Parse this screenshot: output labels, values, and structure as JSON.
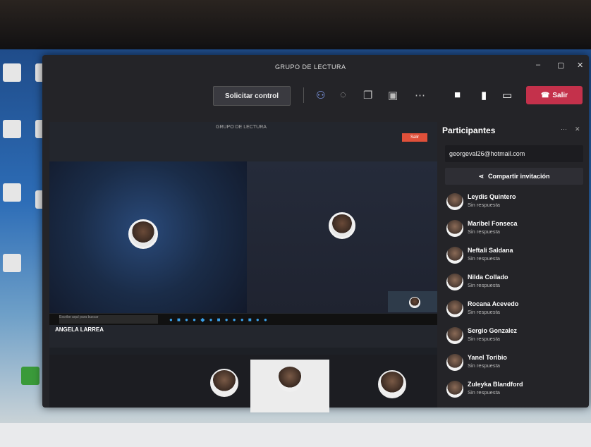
{
  "window": {
    "title": "GRUPO DE LECTURA",
    "minimize": "–",
    "maximize": "▢",
    "close": "✕"
  },
  "toolbar": {
    "control_button": "Solicitar control",
    "leave_button": "Salir",
    "icons": [
      "participants-icon",
      "reactions-icon",
      "chat-icon",
      "share-icon",
      "more-icon",
      "camera-icon",
      "mic-icon",
      "screen-share-icon"
    ]
  },
  "inner_app": {
    "title": "GRUPO DE LECTURA",
    "leave": "Salir"
  },
  "stage": {
    "presenter_name": "ANGELA LARREA",
    "taskbar_search": "Escribe aquí para buscar"
  },
  "participants_panel": {
    "title": "Participantes",
    "invite_email": "georgeval26@hotmail.com",
    "share_invite": "Compartir invitación",
    "participants": [
      {
        "name": "Leydis Quintero",
        "status": "Sin respuesta"
      },
      {
        "name": "Maribel Fonseca",
        "status": "Sin respuesta"
      },
      {
        "name": "Neftali Saldana",
        "status": "Sin respuesta"
      },
      {
        "name": "Nilda Collado",
        "status": "Sin respuesta"
      },
      {
        "name": "Rocana Acevedo",
        "status": "Sin respuesta"
      },
      {
        "name": "Sergio Gonzalez",
        "status": "Sin respuesta"
      },
      {
        "name": "Yanel Toribio",
        "status": "Sin respuesta"
      },
      {
        "name": "Zuleyka Blandford",
        "status": "Sin respuesta"
      }
    ]
  },
  "colors": {
    "accent_leave": "#c4314b",
    "window_bg": "#242428"
  }
}
